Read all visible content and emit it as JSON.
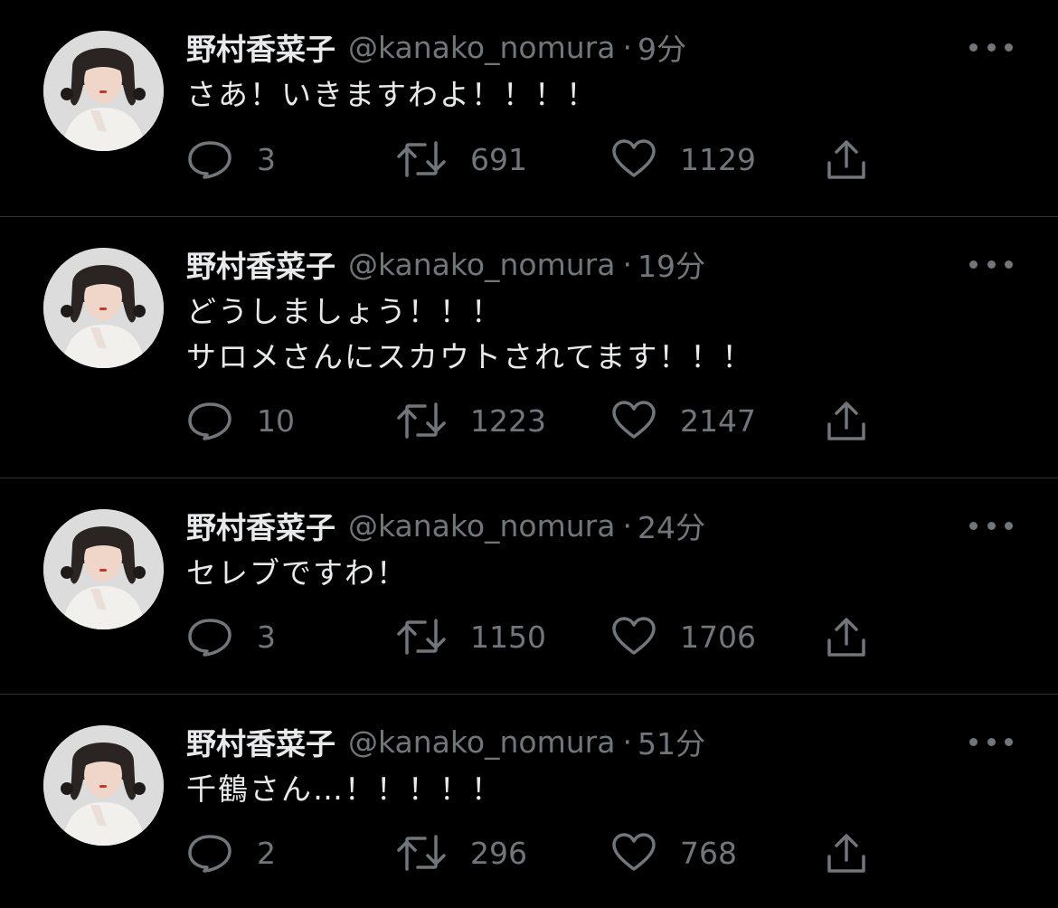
{
  "tweets": [
    {
      "display_name": "野村香菜子",
      "handle": "@kanako_nomura",
      "separator": "·",
      "time": "9分",
      "lines": [
        "さあ！いきますわよ！！！！"
      ],
      "replies": "3",
      "retweets": "691",
      "likes": "1129"
    },
    {
      "display_name": "野村香菜子",
      "handle": "@kanako_nomura",
      "separator": "·",
      "time": "19分",
      "lines": [
        "どうしましょう！！！",
        "サロメさんにスカウトされてます！！！"
      ],
      "replies": "10",
      "retweets": "1223",
      "likes": "2147"
    },
    {
      "display_name": "野村香菜子",
      "handle": "@kanako_nomura",
      "separator": "·",
      "time": "24分",
      "lines": [
        "セレブですわ！"
      ],
      "replies": "3",
      "retweets": "1150",
      "likes": "1706"
    },
    {
      "display_name": "野村香菜子",
      "handle": "@kanako_nomura",
      "separator": "·",
      "time": "51分",
      "lines": [
        "千鶴さん…！！！！！"
      ],
      "replies": "2",
      "retweets": "296",
      "likes": "768"
    }
  ],
  "icons": {
    "reply": "speech-bubble-icon",
    "retweet": "retweet-arrows-icon",
    "like": "heart-icon",
    "share": "share-upload-icon",
    "more": "more-dots-icon"
  },
  "colors": {
    "background": "#000000",
    "text": "#e7e9ea",
    "secondary": "#71767b",
    "divider": "#2f3336"
  }
}
